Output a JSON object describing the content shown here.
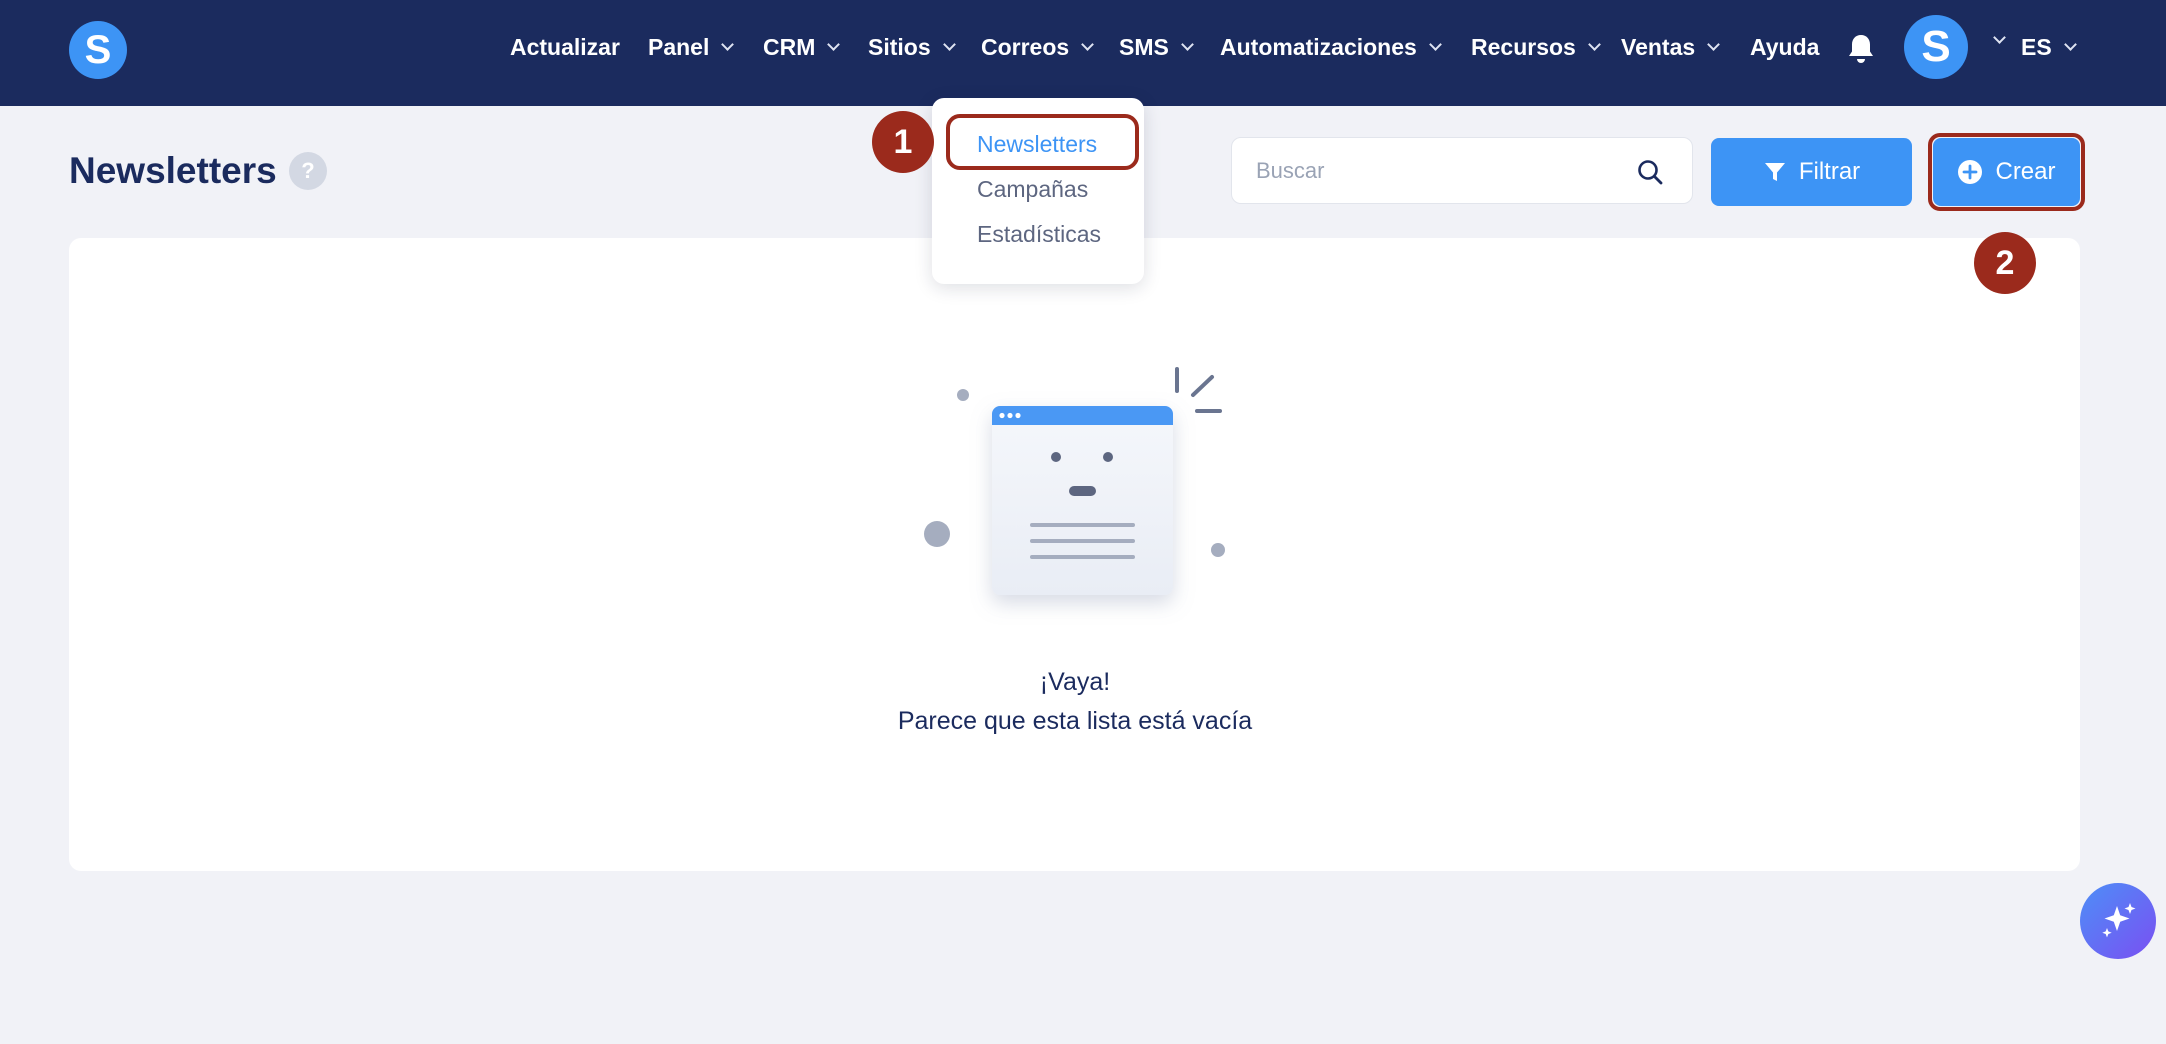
{
  "app": {
    "logo_letter": "S",
    "brand_color": "#3d94f5",
    "nav_background": "#1b2b5e"
  },
  "nav": {
    "items": [
      {
        "label": "Actualizar",
        "has_dropdown": false
      },
      {
        "label": "Panel",
        "has_dropdown": true
      },
      {
        "label": "CRM",
        "has_dropdown": true
      },
      {
        "label": "Sitios",
        "has_dropdown": true
      },
      {
        "label": "Correos",
        "has_dropdown": true
      },
      {
        "label": "SMS",
        "has_dropdown": true
      },
      {
        "label": "Automatizaciones",
        "has_dropdown": true
      },
      {
        "label": "Recursos",
        "has_dropdown": true
      },
      {
        "label": "Ventas",
        "has_dropdown": true
      },
      {
        "label": "Ayuda",
        "has_dropdown": false
      }
    ],
    "notification_icon": "bell-icon",
    "avatar_letter": "S",
    "language": "ES"
  },
  "correos_menu": {
    "items": [
      "Newsletters",
      "Campañas",
      "Estadísticas"
    ],
    "active": "Newsletters"
  },
  "page": {
    "title": "Newsletters",
    "help_icon_glyph": "?",
    "search_placeholder": "Buscar",
    "filter_label": "Filtrar",
    "create_label": "Crear"
  },
  "empty_state": {
    "title": "¡Vaya!",
    "subtitle": "Parece que esta lista está vacía"
  },
  "annotations": {
    "step_1": "1",
    "step_2": "2",
    "highlight_color": "#9b2a1c"
  }
}
